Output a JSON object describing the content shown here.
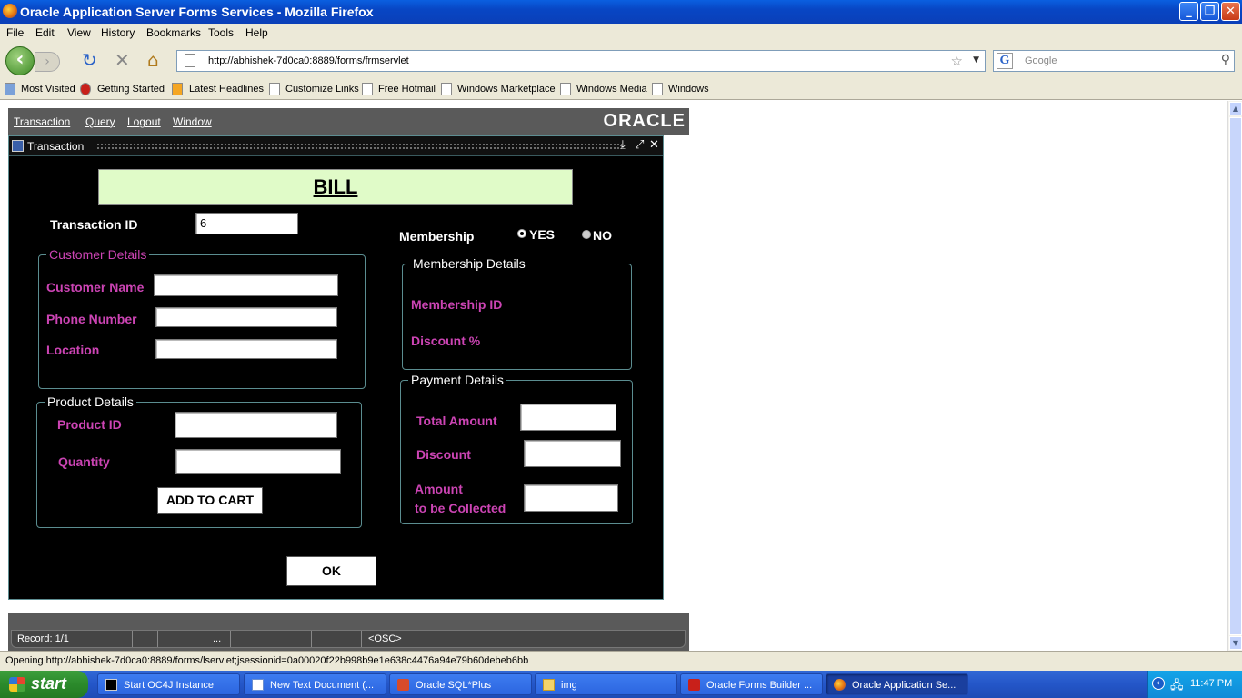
{
  "window": {
    "title": "Oracle Application Server Forms Services - Mozilla Firefox"
  },
  "menubar": [
    "File",
    "Edit",
    "View",
    "History",
    "Bookmarks",
    "Tools",
    "Help"
  ],
  "nav": {
    "url": "http://abhishek-7d0ca0:8889/forms/frmservlet",
    "search_placeholder": "Google"
  },
  "bookmarks": [
    "Most Visited",
    "Getting Started",
    "Latest Headlines",
    "Customize Links",
    "Free Hotmail",
    "Windows Marketplace",
    "Windows Media",
    "Windows"
  ],
  "forms_menu": {
    "items": [
      "Transaction",
      "Query",
      "Logout",
      "Window"
    ],
    "logo": "ORACLE"
  },
  "form": {
    "window_title": "Transaction",
    "heading": "BILL",
    "transaction_id_label": "Transaction ID",
    "transaction_id_value": "6",
    "membership_label": "Membership",
    "membership_yes": "YES",
    "membership_no": "NO",
    "membership_selected": "YES",
    "customer": {
      "legend": "Customer Details",
      "name_label": "Customer Name",
      "phone_label": "Phone Number",
      "location_label": "Location",
      "name_value": "",
      "phone_value": "",
      "location_value": ""
    },
    "product": {
      "legend": "Product Details",
      "id_label": "Product ID",
      "quantity_label": "Quantity",
      "add_button": "ADD TO CART",
      "id_value": "",
      "quantity_value": ""
    },
    "membership_details": {
      "legend": "Membership Details",
      "id_label": "Membership ID",
      "discount_label": "Discount %"
    },
    "payment": {
      "legend": "Payment Details",
      "total_label": "Total Amount",
      "discount_label": "Discount",
      "amount_label_1": "Amount",
      "amount_label_2": "to be Collected",
      "total_value": "",
      "discount_value": "",
      "amount_value": ""
    },
    "ok_button": "OK"
  },
  "applet_status": {
    "record": "Record: 1/1",
    "dots": "...",
    "osc": "<OSC>"
  },
  "ff_status": "Opening http://abhishek-7d0ca0:8889/forms/lservlet;jsessionid=0a00020f22b998b9e1e638c4476a94e79b60debeb6bb",
  "taskbar": {
    "start": "start",
    "tasks": [
      "Start OC4J Instance",
      "New Text Document (...",
      "Oracle SQL*Plus",
      "img",
      "Oracle Forms Builder ...",
      "Oracle Application Se..."
    ],
    "clock": "11:47 PM"
  }
}
